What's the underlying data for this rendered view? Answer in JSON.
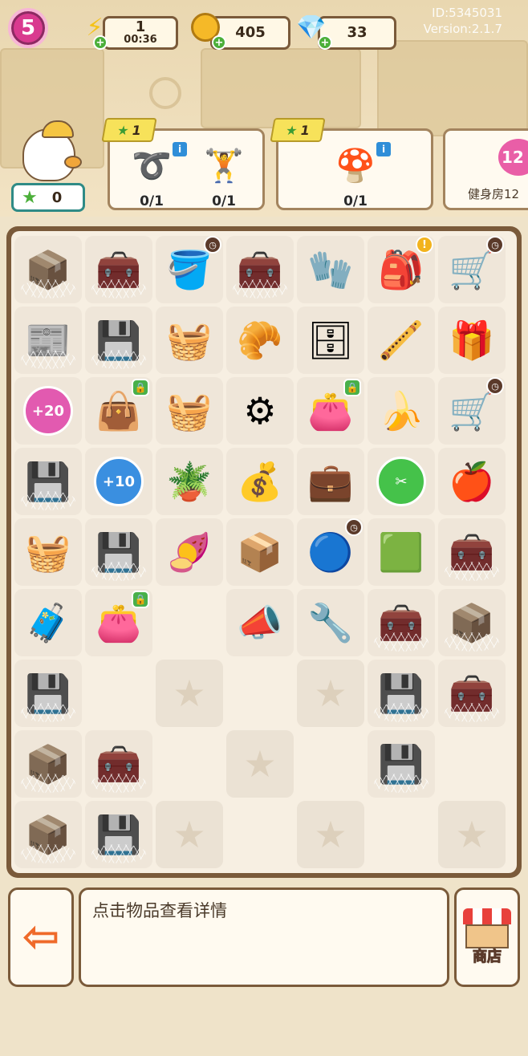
{
  "hud": {
    "level": "5",
    "energy": {
      "value": "1",
      "timer": "00:36"
    },
    "coins": "405",
    "gems": "33",
    "id_text": "ID:5345031",
    "version_text": "Version:2.1.7"
  },
  "orders": {
    "star_count": "0",
    "cards": [
      {
        "reward": "1",
        "items": [
          {
            "icon": "jump-rope-icon",
            "progress": "0/1"
          },
          {
            "icon": "dumbbell-icon",
            "progress": "0/1"
          }
        ]
      },
      {
        "reward": "1",
        "items": [
          {
            "icon": "mushroom-bag-icon",
            "progress": "0/1"
          }
        ]
      }
    ],
    "room": {
      "badge": "12",
      "name": "健身房12"
    }
  },
  "board": {
    "rows": [
      [
        {
          "icon": "cardboard-box-icon",
          "glyph": "📦",
          "web": true
        },
        {
          "icon": "toolbox-icon",
          "glyph": "🧰",
          "web": true
        },
        {
          "icon": "bucket-icon",
          "glyph": "🪣",
          "timer": true
        },
        {
          "icon": "toolbox-icon",
          "glyph": "🧰",
          "web": true
        },
        {
          "icon": "glove-icon",
          "glyph": "🧤"
        },
        {
          "icon": "backpack-icon",
          "glyph": "🎒",
          "alert": true
        },
        {
          "icon": "shopping-cart-icon",
          "glyph": "🛒",
          "timer": true
        }
      ],
      [
        {
          "icon": "newspaper-icon",
          "glyph": "📰",
          "web": true
        },
        {
          "icon": "cpu-chip-icon",
          "glyph": "💾",
          "web": true
        },
        {
          "icon": "basket-trowel-icon",
          "glyph": "🧺"
        },
        {
          "icon": "bread-rolls-icon",
          "glyph": "🥐"
        },
        {
          "icon": "drawer-cabinet-icon",
          "glyph": "🗄"
        },
        {
          "icon": "pipe-icon",
          "glyph": "🪈"
        },
        {
          "icon": "green-box-icon",
          "glyph": "🎁"
        }
      ],
      [
        {
          "icon": "bonus-bubble-icon",
          "bubble": "+20",
          "bubble_color": "#e25ab0"
        },
        {
          "icon": "black-bag-icon",
          "glyph": "👜",
          "lock": true
        },
        {
          "icon": "yellow-basket-icon",
          "glyph": "🧺"
        },
        {
          "icon": "caster-wheel-icon",
          "glyph": "⚙"
        },
        {
          "icon": "pink-bag-icon",
          "glyph": "👛",
          "lock": true
        },
        {
          "icon": "banana-peel-icon",
          "glyph": "🍌"
        },
        {
          "icon": "yellow-cart-icon",
          "glyph": "🛒",
          "timer": true
        }
      ],
      [
        {
          "icon": "cpu-chip-icon",
          "glyph": "💾",
          "web": true
        },
        {
          "icon": "bonus-bubble-icon",
          "bubble": "+10",
          "bubble_color": "#3a8fe0"
        },
        {
          "icon": "potted-plant-icon",
          "glyph": "🪴"
        },
        {
          "icon": "coin-bag-icon",
          "glyph": "💰"
        },
        {
          "icon": "green-case-icon",
          "glyph": "💼"
        },
        {
          "icon": "scissors-bubble-icon",
          "bubble": "✂",
          "bubble_color": "#45c24a"
        },
        {
          "icon": "apple-core-icon",
          "glyph": "🍎"
        }
      ],
      [
        {
          "icon": "basket-dumbbell-icon",
          "glyph": "🧺"
        },
        {
          "icon": "cpu-chip-icon",
          "glyph": "💾",
          "web": true
        },
        {
          "icon": "sweet-potato-icon",
          "glyph": "🍠"
        },
        {
          "icon": "red-toolbox-icon",
          "glyph": "📦"
        },
        {
          "icon": "robot-vacuum-icon",
          "glyph": "🔵",
          "timer": true
        },
        {
          "icon": "green-coin-box-icon",
          "glyph": "🟩"
        },
        {
          "icon": "crate-icon",
          "glyph": "🧰",
          "web": true
        }
      ],
      [
        {
          "icon": "green-suitcase-icon",
          "glyph": "🧳"
        },
        {
          "icon": "pink-bag-icon",
          "glyph": "👛",
          "lock": true
        },
        {
          "empty": true
        },
        {
          "icon": "megaphone-icon",
          "glyph": "📣"
        },
        {
          "icon": "pliers-icon",
          "glyph": "🔧"
        },
        {
          "icon": "crate-icon",
          "glyph": "🧰",
          "web": true
        },
        {
          "icon": "cardboard-box-icon",
          "glyph": "📦",
          "web": true
        }
      ],
      [
        {
          "icon": "cpu-chip-icon",
          "glyph": "💾",
          "web": true
        },
        {
          "empty": true
        },
        {
          "star": true
        },
        {
          "empty": true
        },
        {
          "star": true
        },
        {
          "icon": "cpu-chip-icon",
          "glyph": "💾",
          "web": true
        },
        {
          "icon": "toolbox-icon",
          "glyph": "🧰",
          "web": true
        }
      ],
      [
        {
          "icon": "cardboard-box-icon",
          "glyph": "📦",
          "web": true
        },
        {
          "icon": "crate-icon",
          "glyph": "🧰",
          "web": true
        },
        {
          "empty": true
        },
        {
          "star": true
        },
        {
          "empty": true
        },
        {
          "icon": "cpu-chip-icon",
          "glyph": "💾",
          "web": true
        },
        {
          "empty": true
        }
      ],
      [
        {
          "icon": "cardboard-box-icon",
          "glyph": "📦",
          "web": true
        },
        {
          "icon": "cpu-chip-icon",
          "glyph": "💾",
          "web": true
        },
        {
          "star": true
        },
        {
          "empty": true
        },
        {
          "star": true
        },
        {
          "empty": true
        },
        {
          "star": true
        }
      ]
    ]
  },
  "bottom": {
    "hint": "点击物品查看详情",
    "shop_label": "商店"
  }
}
